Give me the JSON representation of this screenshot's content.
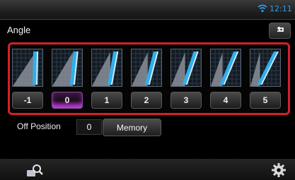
{
  "status_bar": {
    "time": "12:11",
    "wifi_icon": "wifi-icon"
  },
  "header": {
    "title": "Angle",
    "back_icon": "back-arrow-icon"
  },
  "angle_options": [
    {
      "label": "-1",
      "selected": false
    },
    {
      "label": "0",
      "selected": true
    },
    {
      "label": "1",
      "selected": false
    },
    {
      "label": "2",
      "selected": false
    },
    {
      "label": "3",
      "selected": false
    },
    {
      "label": "4",
      "selected": false
    },
    {
      "label": "5",
      "selected": false
    }
  ],
  "off_position": {
    "label": "Off Position",
    "value": "0",
    "memory_label": "Memory"
  },
  "bottom_bar": {
    "left_icon": "search-icon",
    "right_icon": "gear-icon"
  },
  "colors": {
    "accent_blue": "#2f9fe6",
    "selection_red": "#d3202b",
    "active_purple": "#c040e0"
  }
}
